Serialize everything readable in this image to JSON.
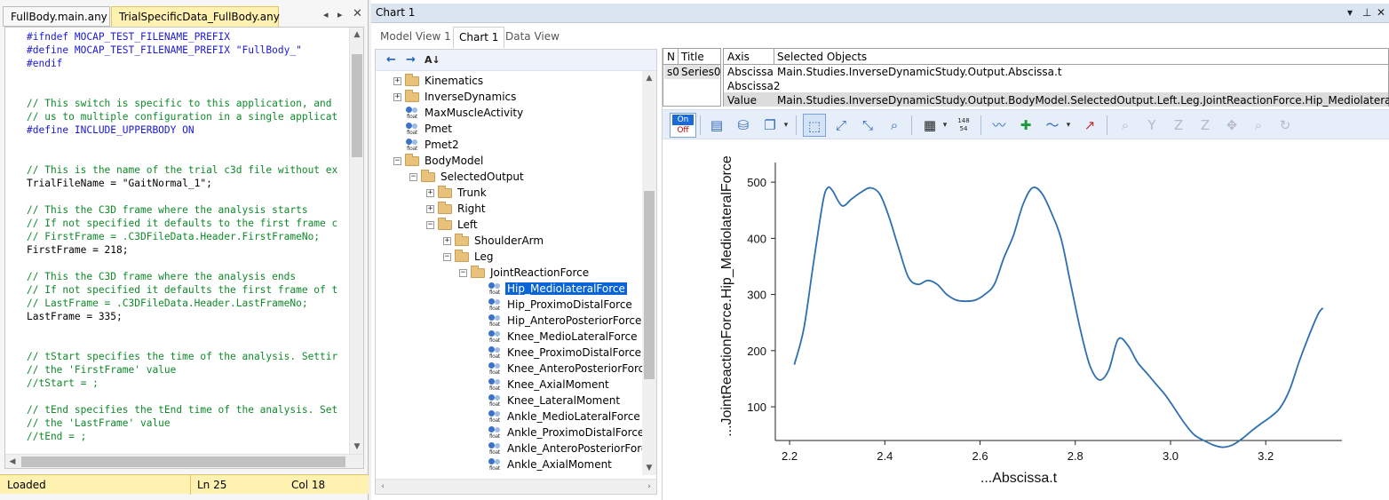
{
  "editor": {
    "tabs": [
      "FullBody.main.any",
      "TrialSpecificData_FullBody.any"
    ],
    "active_tab": 1,
    "code_lines": [
      {
        "t": "pp",
        "text": "#ifndef MOCAP_TEST_FILENAME_PREFIX"
      },
      {
        "t": "pp",
        "text": "#define MOCAP_TEST_FILENAME_PREFIX \"FullBody_\""
      },
      {
        "t": "pp",
        "text": "#endif"
      },
      {
        "t": "tx",
        "text": ""
      },
      {
        "t": "tx",
        "text": ""
      },
      {
        "t": "cm",
        "text": "// This switch is specific to this application, and"
      },
      {
        "t": "cm",
        "text": "// us to multiple configuration in a single applicat"
      },
      {
        "t": "pp",
        "text": "#define INCLUDE_UPPERBODY ON"
      },
      {
        "t": "tx",
        "text": ""
      },
      {
        "t": "tx",
        "text": ""
      },
      {
        "t": "cm",
        "text": "// This is the name of the trial c3d file without ex"
      },
      {
        "t": "tx",
        "text": "TrialFileName = \"GaitNormal_1\";"
      },
      {
        "t": "tx",
        "text": ""
      },
      {
        "t": "cm",
        "text": "// This the C3D frame where the analysis starts"
      },
      {
        "t": "cm",
        "text": "// If not specified it defaults to the first frame c"
      },
      {
        "t": "cm",
        "text": "// FirstFrame = .C3DFileData.Header.FirstFrameNo;"
      },
      {
        "t": "tx",
        "text": "FirstFrame = 218;"
      },
      {
        "t": "tx",
        "text": ""
      },
      {
        "t": "cm",
        "text": "// This the C3D frame where the analysis ends"
      },
      {
        "t": "cm",
        "text": "// If not specified it defaults the first frame of t"
      },
      {
        "t": "cm",
        "text": "// LastFrame = .C3DFileData.Header.LastFrameNo;"
      },
      {
        "t": "tx",
        "text": "LastFrame = 335;"
      },
      {
        "t": "tx",
        "text": ""
      },
      {
        "t": "tx",
        "text": ""
      },
      {
        "t": "cm",
        "text": "// tStart specifies the time of the analysis. Settir"
      },
      {
        "t": "cm",
        "text": "// the 'FirstFrame' value"
      },
      {
        "t": "cm",
        "text": "//tStart = ;"
      },
      {
        "t": "tx",
        "text": ""
      },
      {
        "t": "cm",
        "text": "// tEnd specifies the tEnd time of the analysis. Set"
      },
      {
        "t": "cm",
        "text": "// the 'LastFrame' value"
      },
      {
        "t": "cm",
        "text": "//tEnd = ;"
      }
    ],
    "status": {
      "state": "Loaded",
      "line": "Ln 25",
      "col": "Col 18"
    }
  },
  "chart_window": {
    "title": "Chart 1",
    "view_tabs": [
      "Model View 1",
      "Chart 1",
      "Data View"
    ],
    "active_view_tab": 1
  },
  "tree": {
    "nodes": [
      {
        "label": "Kinematics",
        "depth": 0,
        "kind": "folder",
        "toggle": "+"
      },
      {
        "label": "InverseDynamics",
        "depth": 0,
        "kind": "folder",
        "toggle": "+"
      },
      {
        "label": "MaxMuscleActivity",
        "depth": 0,
        "kind": "float",
        "toggle": ""
      },
      {
        "label": "Pmet",
        "depth": 0,
        "kind": "float",
        "toggle": ""
      },
      {
        "label": "Pmet2",
        "depth": 0,
        "kind": "float",
        "toggle": ""
      },
      {
        "label": "BodyModel",
        "depth": 0,
        "kind": "folder",
        "toggle": "-"
      },
      {
        "label": "SelectedOutput",
        "depth": 1,
        "kind": "folder",
        "toggle": "-"
      },
      {
        "label": "Trunk",
        "depth": 2,
        "kind": "folder",
        "toggle": "+"
      },
      {
        "label": "Right",
        "depth": 2,
        "kind": "folder",
        "toggle": "+"
      },
      {
        "label": "Left",
        "depth": 2,
        "kind": "folder",
        "toggle": "-"
      },
      {
        "label": "ShoulderArm",
        "depth": 3,
        "kind": "folder",
        "toggle": "+"
      },
      {
        "label": "Leg",
        "depth": 3,
        "kind": "folder",
        "toggle": "-"
      },
      {
        "label": "JointReactionForce",
        "depth": 4,
        "kind": "folder",
        "toggle": "-"
      },
      {
        "label": "Hip_MediolateralForce",
        "depth": 5,
        "kind": "float",
        "toggle": "",
        "selected": true
      },
      {
        "label": "Hip_ProximoDistalForce",
        "depth": 5,
        "kind": "float",
        "toggle": ""
      },
      {
        "label": "Hip_AnteroPosteriorForce",
        "depth": 5,
        "kind": "float",
        "toggle": ""
      },
      {
        "label": "Knee_MedioLateralForce",
        "depth": 5,
        "kind": "float",
        "toggle": ""
      },
      {
        "label": "Knee_ProximoDistalForce",
        "depth": 5,
        "kind": "float",
        "toggle": ""
      },
      {
        "label": "Knee_AnteroPosteriorForce",
        "depth": 5,
        "kind": "float",
        "toggle": ""
      },
      {
        "label": "Knee_AxialMoment",
        "depth": 5,
        "kind": "float",
        "toggle": ""
      },
      {
        "label": "Knee_LateralMoment",
        "depth": 5,
        "kind": "float",
        "toggle": ""
      },
      {
        "label": "Ankle_MedioLateralForce",
        "depth": 5,
        "kind": "float",
        "toggle": ""
      },
      {
        "label": "Ankle_ProximoDistalForce",
        "depth": 5,
        "kind": "float",
        "toggle": ""
      },
      {
        "label": "Ankle_AnteroPosteriorForce",
        "depth": 5,
        "kind": "float",
        "toggle": ""
      },
      {
        "label": "Ankle_AxialMoment",
        "depth": 5,
        "kind": "float",
        "toggle": ""
      }
    ]
  },
  "series_table": {
    "headers": {
      "n": "N",
      "title": "Title"
    },
    "series": [
      {
        "n": "s0",
        "title": "Series0"
      }
    ]
  },
  "axis_table": {
    "headers": {
      "axis": "Axis",
      "objects": "Selected Objects"
    },
    "rows": [
      {
        "axis": "Abscissa",
        "objects": "Main.Studies.InverseDynamicStudy.Output.Abscissa.t"
      },
      {
        "axis": "Abscissa2",
        "objects": ""
      },
      {
        "axis": "Value",
        "objects": "Main.Studies.InverseDynamicStudy.Output.BodyModel.SelectedOutput.Left.Leg.JointReactionForce.Hip_MediolateralForce",
        "selected": true
      }
    ]
  },
  "toolbar": {
    "on_label": "On",
    "off_label": "Off",
    "counter_top": "148",
    "counter_bottom": "54"
  },
  "chart_data": {
    "type": "line",
    "xlabel": "...Abscissa.t",
    "ylabel": "...JointReactionForce.Hip_MediolateralForce",
    "xlim": [
      2.17,
      3.36
    ],
    "ylim": [
      40,
      535
    ],
    "xticks": [
      "2.2",
      "2.4",
      "2.6",
      "2.8",
      "3.0",
      "3.2"
    ],
    "yticks": [
      "100",
      "200",
      "300",
      "400",
      "500"
    ],
    "grid": false,
    "line_color": "#2e6fb0",
    "series": [
      {
        "x": [
          2.21,
          2.23,
          2.25,
          2.27,
          2.28,
          2.29,
          2.31,
          2.33,
          2.35,
          2.37,
          2.39,
          2.41,
          2.43,
          2.45,
          2.47,
          2.49,
          2.51,
          2.53,
          2.55,
          2.57,
          2.59,
          2.61,
          2.63,
          2.65,
          2.67,
          2.69,
          2.71,
          2.73,
          2.75,
          2.77,
          2.79,
          2.81,
          2.83,
          2.85,
          2.87,
          2.89,
          2.91,
          2.93,
          2.95,
          2.97,
          2.99,
          3.01,
          3.03,
          3.05,
          3.07,
          3.09,
          3.11,
          3.13,
          3.15,
          3.17,
          3.19,
          3.21,
          3.23,
          3.25,
          3.27,
          3.29,
          3.31,
          3.32
        ],
        "y": [
          175,
          240,
          355,
          465,
          490,
          485,
          458,
          470,
          482,
          490,
          478,
          435,
          380,
          330,
          318,
          325,
          318,
          300,
          290,
          288,
          290,
          300,
          318,
          365,
          405,
          460,
          490,
          480,
          445,
          400,
          320,
          240,
          175,
          148,
          165,
          220,
          210,
          180,
          160,
          140,
          120,
          95,
          70,
          50,
          40,
          32,
          28,
          32,
          43,
          57,
          70,
          82,
          98,
          130,
          180,
          225,
          265,
          276
        ]
      }
    ]
  }
}
